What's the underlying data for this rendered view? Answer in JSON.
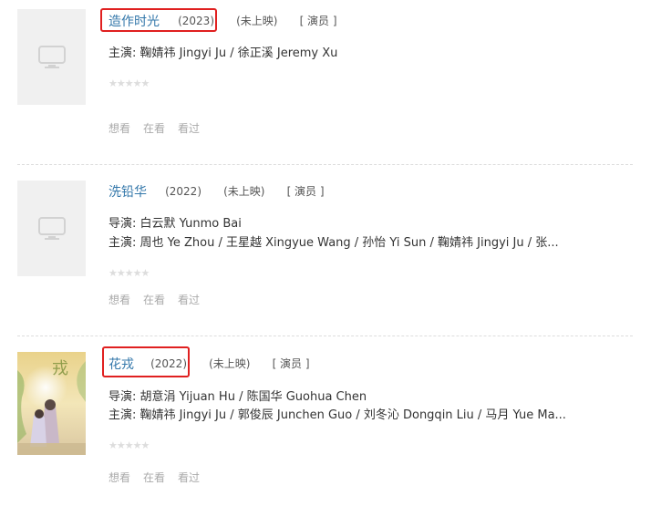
{
  "items": [
    {
      "title": "造作时光",
      "year": "(2023)",
      "status": "(未上映)",
      "role": "[ 演员 ]",
      "lines": [
        "主演: 鞠婧祎 Jingyi Ju / 徐正溪 Jeremy Xu"
      ],
      "rating_stars": 0,
      "actions": [
        "想看",
        "在看",
        "看过"
      ]
    },
    {
      "title": "洗铅华",
      "year": "(2022)",
      "status": "(未上映)",
      "role": "[ 演员 ]",
      "lines": [
        "导演: 白云默 Yunmo Bai",
        "主演: 周也 Ye Zhou / 王星越 Xingyue Wang / 孙怡 Yi Sun / 鞠婧祎 Jingyi Ju / 张..."
      ],
      "rating_stars": 0,
      "actions": [
        "想看",
        "在看",
        "看过"
      ]
    },
    {
      "title": "花戎",
      "year": "(2022)",
      "status": "(未上映)",
      "role": "[ 演员 ]",
      "lines": [
        "导演: 胡意涓 Yijuan Hu / 陈国华 Guohua Chen",
        "主演: 鞠婧祎 Jingyi Ju / 郭俊辰 Junchen Guo / 刘冬沁 Dongqin Liu / 马月 Yue Ma..."
      ],
      "rating_stars": 0,
      "actions": [
        "想看",
        "在看",
        "看过"
      ]
    }
  ],
  "colors": {
    "title_link": "#3377aa",
    "highlight_box": "#e02020",
    "muted_text": "#aaaaaa",
    "placeholder_bg": "#f0f0f0"
  },
  "icons": {
    "placeholder": "tv-icon",
    "star": "star-icon"
  }
}
